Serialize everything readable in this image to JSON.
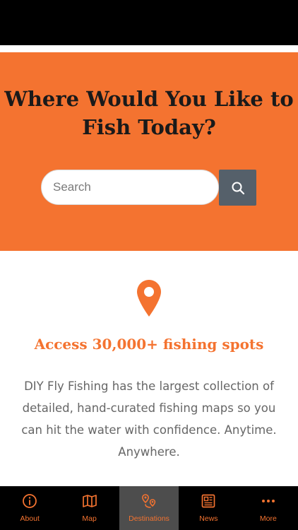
{
  "colors": {
    "accent": "#f47330",
    "button": "#55606a",
    "tab_active_bg": "#4d4d4d",
    "bar": "#000000"
  },
  "hero": {
    "title_line1": "Where Would You Like to",
    "title_line2": "Fish Today?",
    "search": {
      "placeholder": "Search",
      "value": "",
      "button_icon": "search-icon"
    }
  },
  "feature": {
    "icon": "map-pin-icon",
    "title": "Access 30,000+ fishing spots",
    "body": "DIY Fly Fishing has the largest collection of detailed, hand-curated fishing maps so you can hit the water with confidence. Anytime. Anywhere."
  },
  "tabs": [
    {
      "label": "About",
      "icon": "info-icon",
      "active": false
    },
    {
      "label": "Map",
      "icon": "map-icon",
      "active": false
    },
    {
      "label": "Destinations",
      "icon": "route-pins-icon",
      "active": true
    },
    {
      "label": "News",
      "icon": "news-icon",
      "active": false
    },
    {
      "label": "More",
      "icon": "more-dots-icon",
      "active": false
    }
  ]
}
